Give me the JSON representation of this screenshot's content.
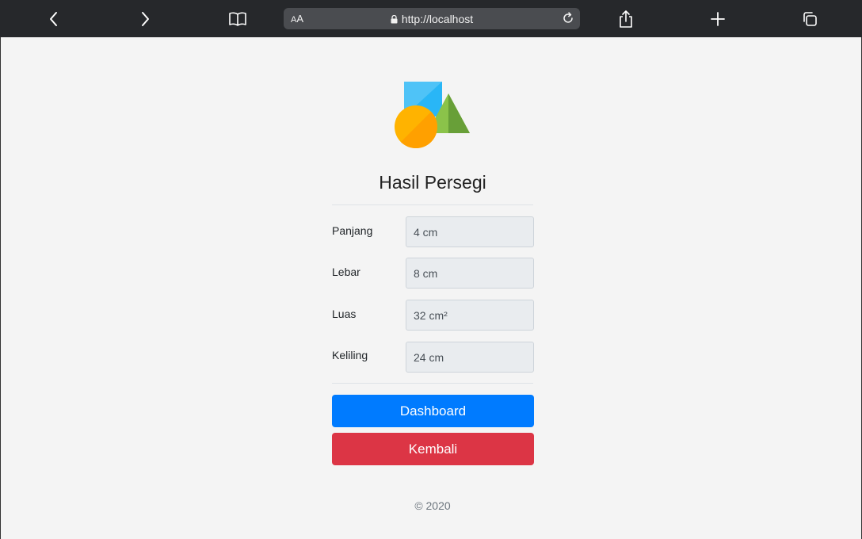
{
  "browser": {
    "url": "http://localhost",
    "text_size_label_small": "A",
    "text_size_label_big": "A"
  },
  "page": {
    "title": "Hasil Persegi",
    "fields": [
      {
        "label": "Panjang",
        "value": "4 cm"
      },
      {
        "label": "Lebar",
        "value": "8 cm"
      },
      {
        "label": "Luas",
        "value": "32 cm²"
      },
      {
        "label": "Keliling",
        "value": "24 cm"
      }
    ],
    "buttons": {
      "dashboard": "Dashboard",
      "back": "Kembali"
    },
    "footer": "© 2020"
  },
  "colors": {
    "toolbar": "#26282b",
    "primary": "#007bff",
    "danger": "#dc3545",
    "input_bg": "#e9ecef"
  },
  "icons": [
    "back-icon",
    "forward-icon",
    "bookmarks-icon",
    "lock-icon",
    "reload-icon",
    "share-icon",
    "new-tab-icon",
    "tabs-icon",
    "shapes-logo"
  ]
}
